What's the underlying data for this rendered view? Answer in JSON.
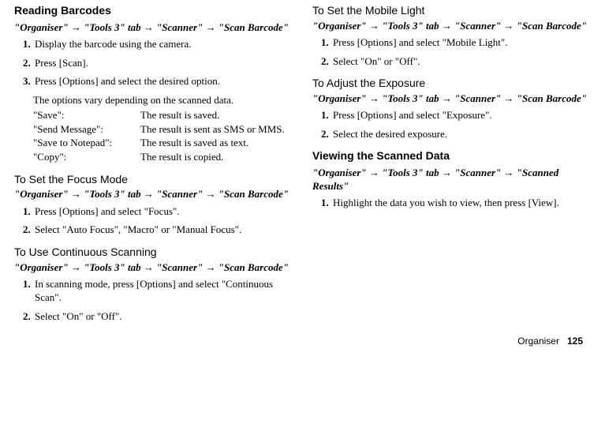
{
  "left": {
    "h_reading": "Reading Barcodes",
    "path_scan": "\"Organiser\" → \"Tools 3\" tab → \"Scanner\" → \"Scan Barcode\"",
    "steps_reading": [
      "Display the barcode using the camera.",
      "Press [Scan].",
      "Press [Options] and select the desired option."
    ],
    "options_intro": "The options vary depending on the scanned data.",
    "options": [
      {
        "label": "\"Save\":",
        "desc": "The result is saved."
      },
      {
        "label": "\"Send Message\":",
        "desc": "The result is sent as SMS or MMS."
      },
      {
        "label": "\"Save to Notepad\":",
        "desc": "The result is saved as text."
      },
      {
        "label": "\"Copy\":",
        "desc": "The result is copied."
      }
    ],
    "h_focus": "To Set the Focus Mode",
    "steps_focus": [
      "Press [Options] and select \"Focus\".",
      "Select \"Auto Focus\", \"Macro\" or \"Manual Focus\"."
    ],
    "h_cont": "To Use Continuous Scanning",
    "steps_cont": [
      "In scanning mode, press [Options] and select \"Continuous Scan\".",
      "Select \"On\" or \"Off\"."
    ]
  },
  "right": {
    "h_light": "To Set the Mobile Light",
    "path_scan": "\"Organiser\" → \"Tools 3\" tab → \"Scanner\" → \"Scan Barcode\"",
    "steps_light": [
      "Press [Options] and select \"Mobile Light\".",
      "Select \"On\" or \"Off\"."
    ],
    "h_exp": "To Adjust the Exposure",
    "steps_exp": [
      "Press [Options] and select \"Exposure\".",
      "Select the desired exposure."
    ],
    "h_view": "Viewing the Scanned Data",
    "path_results": "\"Organiser\" → \"Tools 3\" tab → \"Scanner\" → \"Scanned Results\"",
    "steps_view": [
      "Highlight the data you wish to view, then press [View]."
    ]
  },
  "footer": {
    "section": "Organiser",
    "page": "125"
  }
}
